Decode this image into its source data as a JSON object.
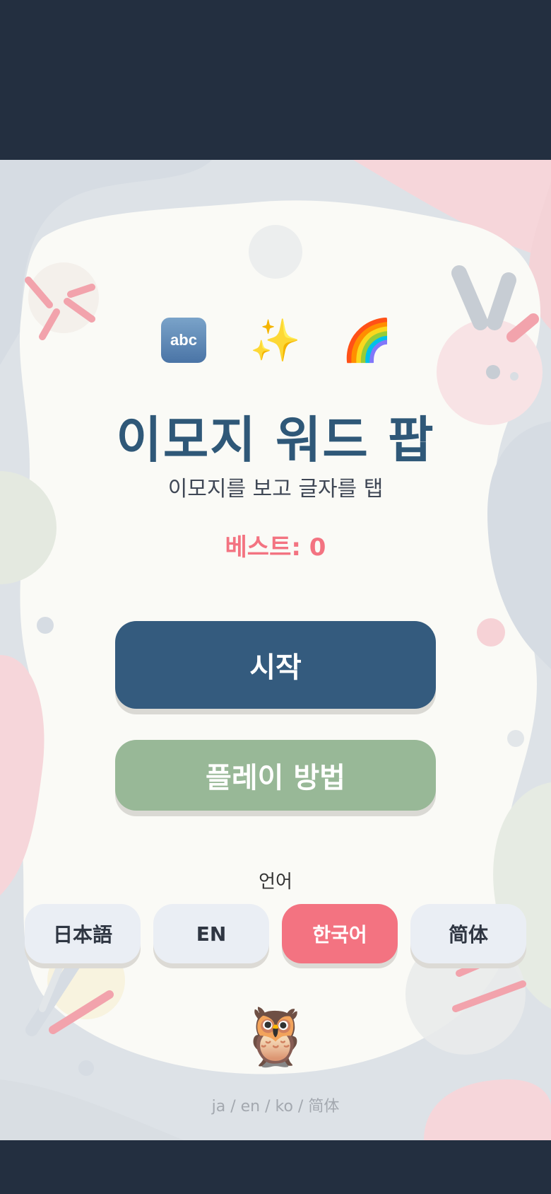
{
  "header": {
    "emojis": [
      "🔤",
      "✨",
      "🌈"
    ],
    "abc_text": "abc",
    "title": "이모지 워드 팝",
    "subtitle": "이모지를 보고 글자를 탭",
    "best_label": "베스트: 0"
  },
  "buttons": {
    "start_label": "시작",
    "how_to_play_label": "플레이 방법"
  },
  "language": {
    "label": "언어",
    "options": [
      "日本語",
      "EN",
      "한국어",
      "简体"
    ],
    "selected": "한국어"
  },
  "footer": {
    "mascot": "🦉",
    "languages_text": "ja / en / ko / 简体"
  },
  "colors": {
    "title": "#2f5878",
    "accent": "#f37381",
    "primary_button": "#345b7e",
    "secondary_button": "#98b897",
    "frame": "#232f40"
  }
}
